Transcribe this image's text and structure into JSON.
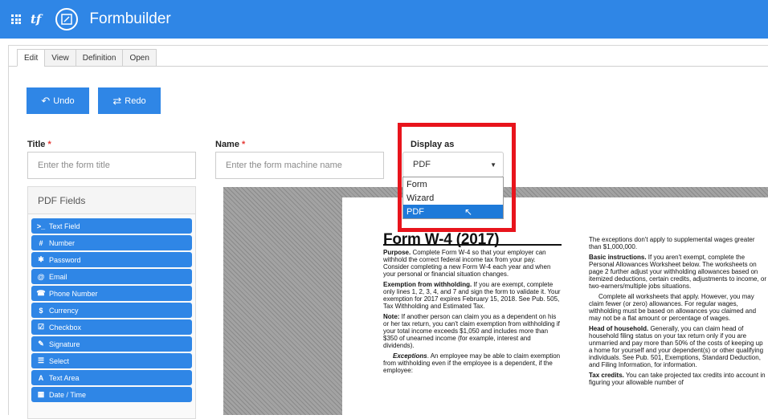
{
  "header": {
    "app_title": "Formbuilder",
    "logo_text": "tf"
  },
  "tabs": [
    "Edit",
    "View",
    "Definition",
    "Open"
  ],
  "toolbar": {
    "undo_label": "Undo",
    "redo_label": "Redo"
  },
  "title_field": {
    "label": "Title",
    "required": "*",
    "placeholder": "Enter the form title"
  },
  "name_field": {
    "label": "Name",
    "required": "*",
    "placeholder": "Enter the form machine name"
  },
  "display_as": {
    "label": "Display as",
    "selected": "PDF",
    "options": [
      "Form",
      "Wizard",
      "PDF"
    ]
  },
  "pdf_fields": {
    "heading": "PDF Fields",
    "items": [
      "Text Field",
      "Number",
      "Password",
      "Email",
      "Phone Number",
      "Currency",
      "Checkbox",
      "Signature",
      "Select",
      "Text Area",
      "Date / Time"
    ],
    "icons": [
      "terminal-icon",
      "hash-icon",
      "asterisk-icon",
      "at-icon",
      "phone-icon",
      "dollar-icon",
      "checkbox-icon",
      "pen-icon",
      "list-icon",
      "font-icon",
      "calendar-icon"
    ]
  },
  "document": {
    "title": "Form W-4 (2017)",
    "left": [
      {
        "bold": "Purpose.",
        "text": " Complete Form W-4 so that your employer can withhold the correct federal income tax from your pay. Consider completing a new Form W-4 each year and when your personal or financial situation changes."
      },
      {
        "bold": "Exemption from withholding.",
        "text": " If you are exempt, complete only lines 1, 2, 3, 4, and 7 and sign the form to validate it. Your exemption for 2017 expires February 15, 2018. See Pub. 505, Tax Withholding and Estimated Tax."
      },
      {
        "bold": "Note:",
        "text": " If another person can claim you as a dependent on his or her tax return, you can't claim exemption from withholding if your total income exceeds $1,050 and includes more than $350 of unearned income (for example, interest and dividends)."
      },
      {
        "bold": "Exceptions",
        "text": ". An employee may be able to claim exemption from withholding even if the employee is a dependent, if the employee:"
      }
    ],
    "right": [
      {
        "bold": "",
        "text": "The exceptions don't apply to supplemental wages greater than $1,000,000."
      },
      {
        "bold": "Basic instructions.",
        "text": " If you aren't exempt, complete the Personal Allowances Worksheet below. The worksheets on page 2 further adjust your withholding allowances based on itemized deductions, certain credits, adjustments to income, or two-earners/multiple jobs situations."
      },
      {
        "bold": "",
        "text": "Complete all worksheets that apply. However, you may claim fewer (or zero) allowances. For regular wages, withholding must be based on allowances you claimed and may not be a flat amount or percentage of wages."
      },
      {
        "bold": "Head of household.",
        "text": " Generally, you can claim head of household filing status on your tax return only if you are unmarried and pay more than 50% of the costs of keeping up a home for yourself and your dependent(s) or other qualifying individuals. See Pub. 501, Exemptions, Standard Deduction, and Filing Information, for information."
      },
      {
        "bold": "Tax credits.",
        "text": " You can take projected tax credits into account in figuring your allowable number of"
      }
    ]
  },
  "colors": {
    "brand": "#2f86e6",
    "highlight": "#e8141c",
    "selected_option": "#1e7ad9"
  }
}
